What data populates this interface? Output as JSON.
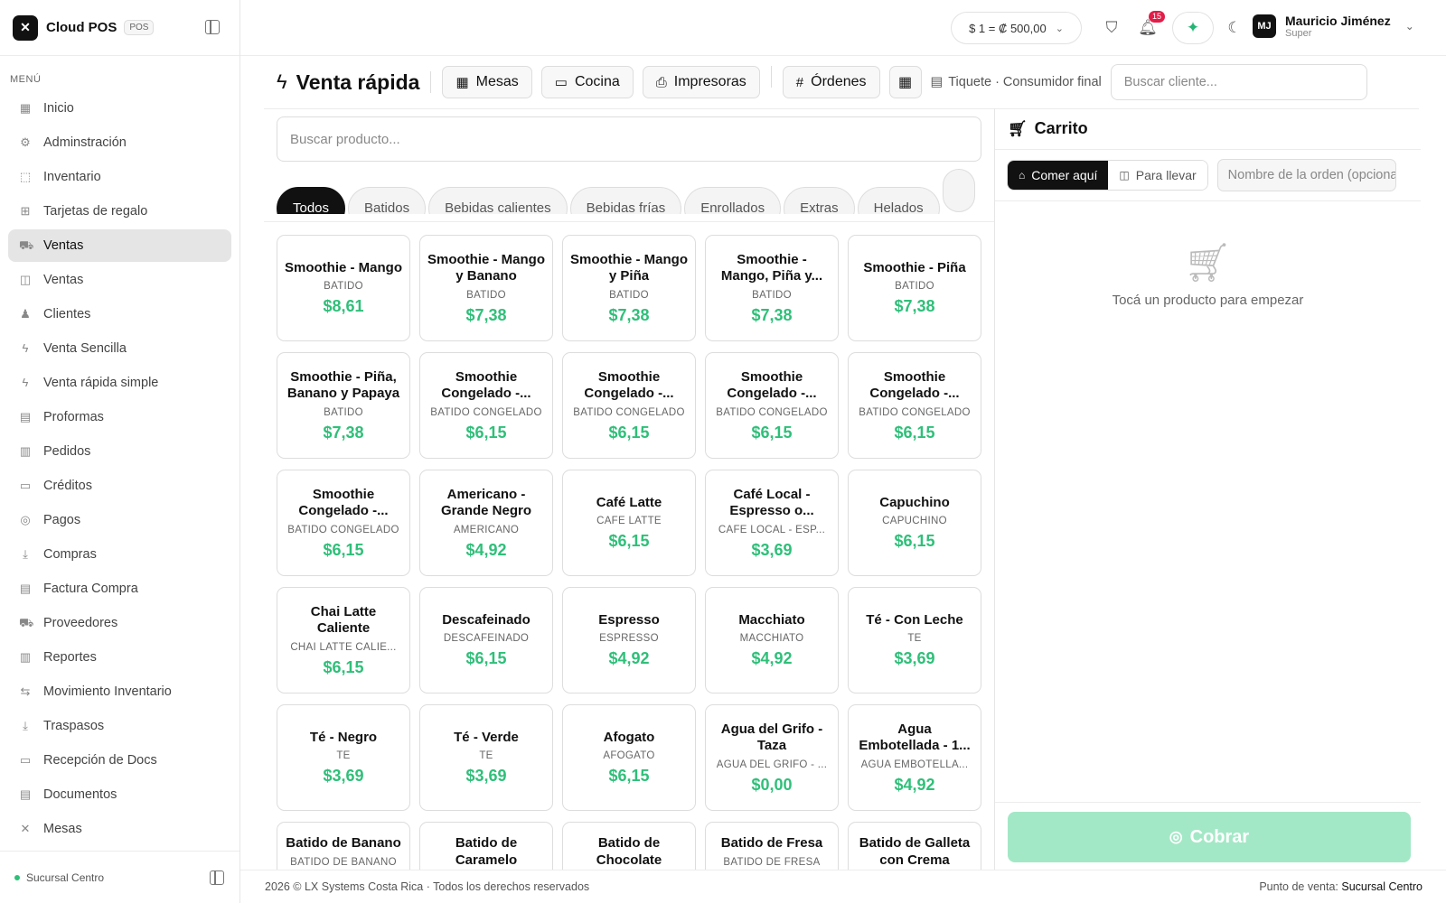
{
  "app": {
    "name": "Cloud POS",
    "tag": "POS"
  },
  "sidebar": {
    "menu_title": "MENÚ",
    "items": [
      {
        "label": "Inicio",
        "icon": "grid-icon"
      },
      {
        "label": "Adminstración",
        "icon": "gear-icon"
      },
      {
        "label": "Inventario",
        "icon": "box-icon"
      },
      {
        "label": "Tarjetas de regalo",
        "icon": "gift-icon"
      },
      {
        "label": "Ventas",
        "icon": "cart-icon",
        "active": true
      },
      {
        "label": "Ventas",
        "icon": "bag-icon"
      },
      {
        "label": "Clientes",
        "icon": "users-icon"
      },
      {
        "label": "Venta Sencilla",
        "icon": "bolt-icon"
      },
      {
        "label": "Venta rápida simple",
        "icon": "bolt-icon"
      },
      {
        "label": "Proformas",
        "icon": "file-icon"
      },
      {
        "label": "Pedidos",
        "icon": "clipboard-icon"
      },
      {
        "label": "Créditos",
        "icon": "card-icon"
      },
      {
        "label": "Pagos",
        "icon": "coins-icon"
      },
      {
        "label": "Compras",
        "icon": "download-icon"
      },
      {
        "label": "Factura Compra",
        "icon": "receipt-icon"
      },
      {
        "label": "Proveedores",
        "icon": "truck-icon"
      },
      {
        "label": "Reportes",
        "icon": "chart-icon"
      },
      {
        "label": "Movimiento Inventario",
        "icon": "arrows-icon"
      },
      {
        "label": "Traspasos",
        "icon": "download-icon"
      },
      {
        "label": "Recepción de Docs",
        "icon": "inbox-icon"
      },
      {
        "label": "Documentos",
        "icon": "file-icon"
      },
      {
        "label": "Mesas",
        "icon": "utensils-icon"
      }
    ],
    "branch": "Sucursal Centro"
  },
  "topbar": {
    "rate": "$ 1 = ₡ 500,00",
    "notifications": "15",
    "user_name": "Mauricio Jiménez",
    "user_role": "Super",
    "user_initials": "MJ"
  },
  "header": {
    "title": "Venta rápida",
    "buttons": [
      {
        "label": "Mesas",
        "icon": "grid-icon"
      },
      {
        "label": "Cocina",
        "icon": "monitor-icon"
      },
      {
        "label": "Impresoras",
        "icon": "printer-icon"
      },
      {
        "label": "Órdenes",
        "icon": "hash-icon"
      }
    ],
    "ticket": "Tiquete · Consumidor final",
    "client_placeholder": "Buscar cliente..."
  },
  "search": {
    "placeholder": "Buscar producto..."
  },
  "categories": [
    "Todos",
    "Batidos",
    "Bebidas calientes",
    "Bebidas frías",
    "Enrollados",
    "Extras",
    "Helados",
    ""
  ],
  "products": [
    {
      "name": "Smoothie - Mango",
      "category": "BATIDO",
      "price": "$8,61"
    },
    {
      "name": "Smoothie - Mango y Banano",
      "category": "BATIDO",
      "price": "$7,38"
    },
    {
      "name": "Smoothie - Mango y Piña",
      "category": "BATIDO",
      "price": "$7,38"
    },
    {
      "name": "Smoothie - Mango, Piña y...",
      "category": "BATIDO",
      "price": "$7,38"
    },
    {
      "name": "Smoothie - Piña",
      "category": "BATIDO",
      "price": "$7,38"
    },
    {
      "name": "Smoothie - Piña, Banano y Papaya",
      "category": "BATIDO",
      "price": "$7,38"
    },
    {
      "name": "Smoothie Congelado -...",
      "category": "BATIDO CONGELADO",
      "price": "$6,15"
    },
    {
      "name": "Smoothie Congelado -...",
      "category": "BATIDO CONGELADO",
      "price": "$6,15"
    },
    {
      "name": "Smoothie Congelado -...",
      "category": "BATIDO CONGELADO",
      "price": "$6,15"
    },
    {
      "name": "Smoothie Congelado -...",
      "category": "BATIDO CONGELADO",
      "price": "$6,15"
    },
    {
      "name": "Smoothie Congelado -...",
      "category": "BATIDO CONGELADO",
      "price": "$6,15"
    },
    {
      "name": "Americano - Grande Negro",
      "category": "AMERICANO",
      "price": "$4,92"
    },
    {
      "name": "Café Latte",
      "category": "CAFÉ LATTE",
      "price": "$6,15"
    },
    {
      "name": "Café Local - Espresso o...",
      "category": "CAFÉ LOCAL - ESP...",
      "price": "$3,69"
    },
    {
      "name": "Capuchino",
      "category": "CAPUCHINO",
      "price": "$6,15"
    },
    {
      "name": "Chai Latte Caliente",
      "category": "CHAI LATTE CALIE...",
      "price": "$6,15"
    },
    {
      "name": "Descafeinado",
      "category": "DESCAFEINADO",
      "price": "$6,15"
    },
    {
      "name": "Espresso",
      "category": "ESPRESSO",
      "price": "$4,92"
    },
    {
      "name": "Macchiato",
      "category": "MACCHIATO",
      "price": "$4,92"
    },
    {
      "name": "Té - Con Leche",
      "category": "TÉ",
      "price": "$3,69"
    },
    {
      "name": "Té - Negro",
      "category": "TÉ",
      "price": "$3,69"
    },
    {
      "name": "Té - Verde",
      "category": "TÉ",
      "price": "$3,69"
    },
    {
      "name": "Afogato",
      "category": "AFOGATO",
      "price": "$6,15"
    },
    {
      "name": "Agua del Grifo - Taza",
      "category": "AGUA DEL GRIFO - ...",
      "price": "$0,00"
    },
    {
      "name": "Agua Embotellada - 1...",
      "category": "AGUA EMBOTELLA...",
      "price": "$4,92"
    },
    {
      "name": "Batido de Banano",
      "category": "BATIDO DE BANANO",
      "price": ""
    },
    {
      "name": "Batido de Caramelo",
      "category": "",
      "price": ""
    },
    {
      "name": "Batido de Chocolate",
      "category": "",
      "price": ""
    },
    {
      "name": "Batido de Fresa",
      "category": "BATIDO DE FRESA",
      "price": ""
    },
    {
      "name": "Batido de Galleta con Crema",
      "category": "",
      "price": ""
    }
  ],
  "cart": {
    "title": "Carrito",
    "dine_in": "Comer aquí",
    "take_away": "Para llevar",
    "order_name_placeholder": "Nombre de la orden (opcional)",
    "empty_text": "Tocá un producto para empezar",
    "checkout": "Cobrar"
  },
  "footer": {
    "copyright": "2026 © LX Systems Costa Rica · Todos los derechos reservados",
    "pos_label": "Punto de venta:",
    "pos_value": "Sucursal Centro"
  },
  "colors": {
    "accent": "#2fbf79",
    "checkout_disabled": "#a3e8c6",
    "badge": "#e11d48"
  }
}
